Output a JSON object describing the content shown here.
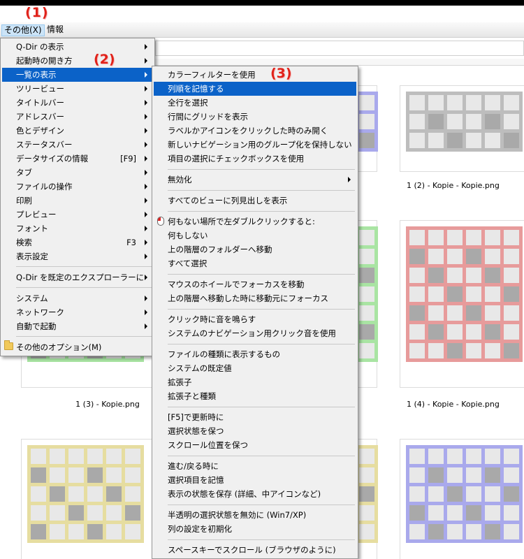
{
  "annotations": {
    "a1": "(1)",
    "a2": "(2)",
    "a3": "(3)"
  },
  "menubar": {
    "other": "その他(X)",
    "info": "情報"
  },
  "captions": {
    "c1": "1 (2) - Kopie - Kopie.png",
    "c2": "1 (3) - Kopie.png",
    "c3": "1 (4) - Kopie - Kopie.png"
  },
  "colors": {
    "highlight": "#0b62c8",
    "annotation": "#e0221a",
    "thumb_gray": "#bdbdbd",
    "thumb_green": "#a9e4a3",
    "thumb_red": "#e79b9b",
    "thumb_yellow": "#e6dda0",
    "thumb_blue": "#a9a9ec"
  },
  "main_menu": {
    "items": [
      {
        "label": "Q-Dir の表示",
        "arrow": true
      },
      {
        "label": "起動時の開き方",
        "arrow": true
      },
      {
        "label": "一覧の表示",
        "arrow": true,
        "highlight": true
      },
      {
        "label": "ツリービュー",
        "arrow": true
      },
      {
        "label": "タイトルバー",
        "arrow": true
      },
      {
        "label": "アドレスバー",
        "arrow": true
      },
      {
        "label": "色とデザイン",
        "arrow": true
      },
      {
        "label": "ステータスバー",
        "arrow": true
      },
      {
        "label": "データサイズの情報",
        "shortcut": "[F9]",
        "arrow": true
      },
      {
        "label": "タブ",
        "arrow": true
      },
      {
        "label": "ファイルの操作",
        "arrow": true
      },
      {
        "label": "印刷",
        "arrow": true
      },
      {
        "label": "プレビュー",
        "arrow": true
      },
      {
        "label": "フォント",
        "arrow": true
      },
      {
        "label": "検索",
        "shortcut": "F3",
        "arrow": true
      },
      {
        "label": "表示設定",
        "arrow": true
      },
      {
        "label": "Q-Dir を既定のエクスプローラーに",
        "arrow": true
      },
      {
        "label": "システム",
        "arrow": true
      },
      {
        "label": "ネットワーク",
        "arrow": true
      },
      {
        "label": "自動で起動",
        "arrow": true
      },
      {
        "label": "その他のオプション(M)",
        "icon": "folder-icon"
      }
    ]
  },
  "sub_menu": {
    "items": [
      {
        "label": "カラーフィルターを使用"
      },
      {
        "label": "列順を記憶する",
        "highlight": true
      },
      {
        "label": "全行を選択"
      },
      {
        "label": "行間にグリッドを表示"
      },
      {
        "label": "ラベルかアイコンをクリックした時のみ開く"
      },
      {
        "label": "新しいナビゲーション用のグループ化を保持しない"
      },
      {
        "label": "項目の選択にチェックボックスを使用"
      },
      {
        "label": "無効化",
        "arrow": true
      },
      {
        "label": "すべてのビューに列見出しを表示"
      },
      {
        "label": "何もない場所で左ダブルクリックすると:",
        "icon": "mouse-icon"
      },
      {
        "label": "何もしない"
      },
      {
        "label": "上の階層のフォルダーへ移動"
      },
      {
        "label": "すべて選択"
      },
      {
        "label": "マウスのホイールでフォーカスを移動"
      },
      {
        "label": "上の階層へ移動した時に移動元にフォーカス"
      },
      {
        "label": "クリック時に音を鳴らす"
      },
      {
        "label": "システムのナビゲーション用クリック音を使用"
      },
      {
        "label": "ファイルの種類に表示するもの"
      },
      {
        "label": "システムの既定値"
      },
      {
        "label": "拡張子"
      },
      {
        "label": "拡張子と種類"
      },
      {
        "label": "[F5]で更新時に"
      },
      {
        "label": "選択状態を保つ"
      },
      {
        "label": "スクロール位置を保つ"
      },
      {
        "label": "進む/戻る時に"
      },
      {
        "label": "選択項目を記憶"
      },
      {
        "label": "表示の状態を保存 (詳細、中アイコンなど)"
      },
      {
        "label": "半透明の選択状態を無効に (Win7/XP)"
      },
      {
        "label": "列の設定を初期化"
      },
      {
        "label": "スペースキーでスクロール (ブラウザのように)"
      }
    ]
  }
}
